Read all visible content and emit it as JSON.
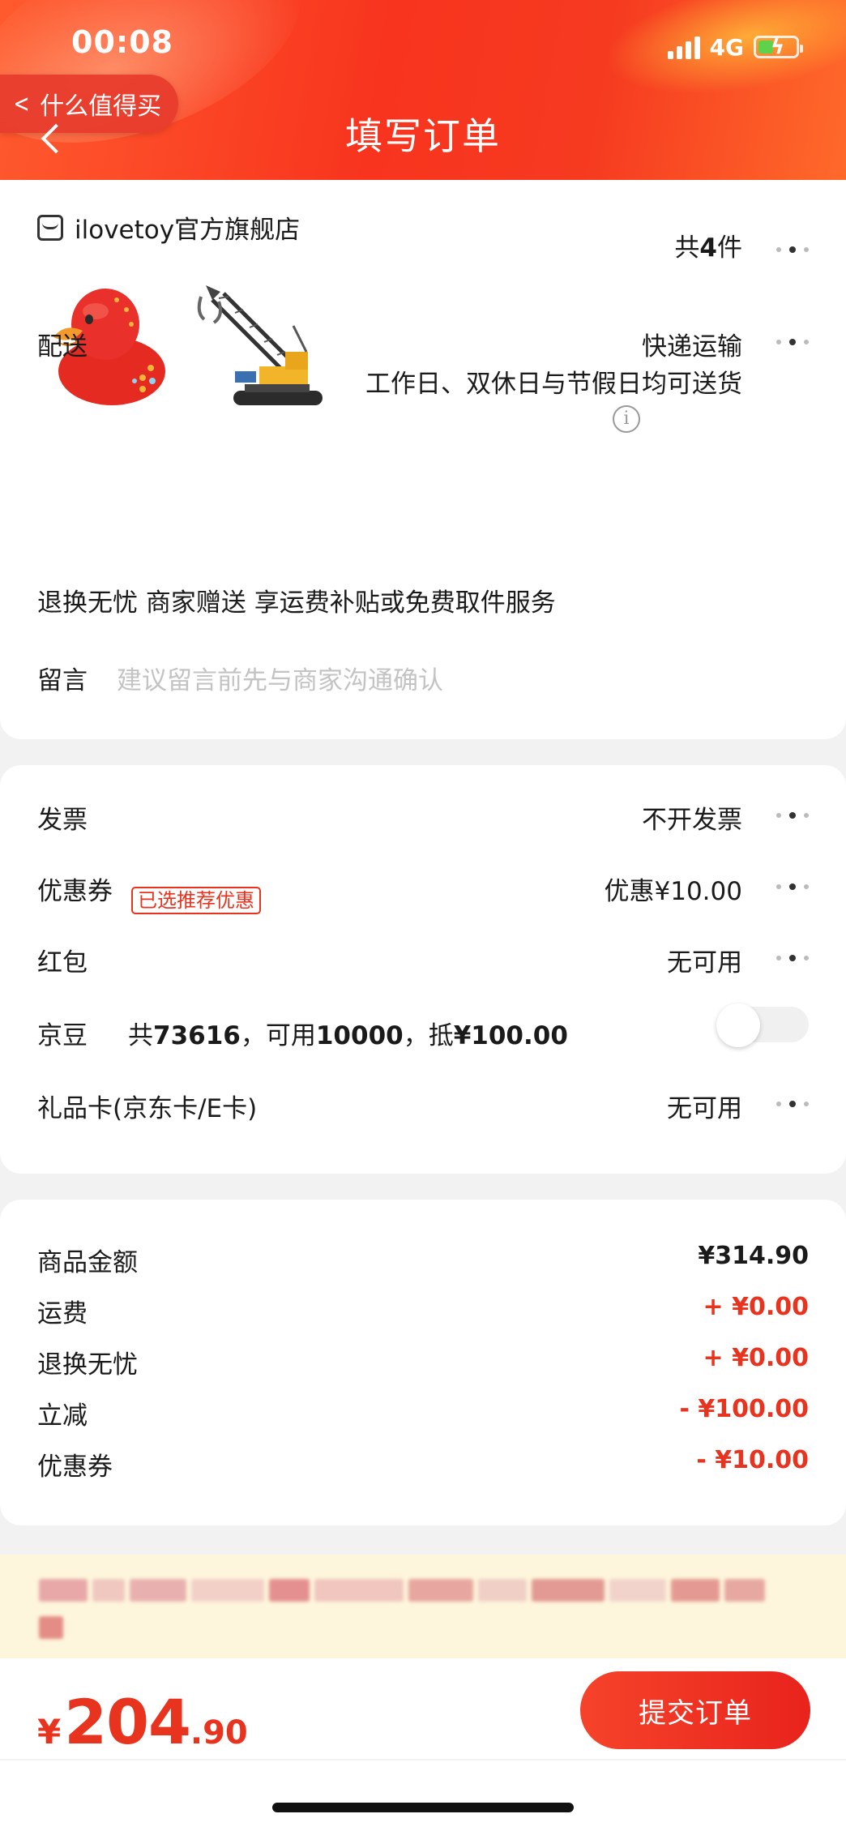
{
  "status_bar": {
    "time": "00:08",
    "network": "4G"
  },
  "nav": {
    "back_app_label": "什么值得买",
    "title": "填写订单"
  },
  "store": {
    "name": "ilovetoy官方旗舰店"
  },
  "products": {
    "count_prefix": "共",
    "count": "4",
    "count_suffix": "件"
  },
  "delivery": {
    "label": "配送",
    "method": "快递运输",
    "schedule": "工作日、双休日与节假日均可送货"
  },
  "return_service": {
    "text": "退换无忧 商家赠送 享运费补贴或免费取件服务"
  },
  "message": {
    "label": "留言",
    "placeholder": "建议留言前先与商家沟通确认"
  },
  "invoice": {
    "label": "发票",
    "value": "不开发票"
  },
  "coupon": {
    "label": "优惠券",
    "tag": "已选推荐优惠",
    "value": "优惠¥10.00"
  },
  "red_packet": {
    "label": "红包",
    "value": "无可用"
  },
  "jingdou": {
    "label": "京豆",
    "total_prefix": "共",
    "total": "73616",
    "usable_prefix": "，可用",
    "usable": "10000",
    "deduct_prefix": "，抵",
    "deduct": "¥100.00",
    "toggle_on": false
  },
  "gift_card": {
    "label": "礼品卡(京东卡/E卡)",
    "value": "无可用"
  },
  "amounts": [
    {
      "label": "商品金额",
      "value": "¥314.90",
      "color": "#1a1a1a"
    },
    {
      "label": "运费",
      "value": "+ ¥0.00",
      "color": "#e8331f"
    },
    {
      "label": "退换无忧",
      "value": "+ ¥0.00",
      "color": "#e8331f"
    },
    {
      "label": "立减",
      "value": "- ¥100.00",
      "color": "#e8331f"
    },
    {
      "label": "优惠券",
      "value": "- ¥10.00",
      "color": "#e8331f"
    }
  ],
  "total": {
    "currency": "¥",
    "integer": "204",
    "decimal": ".90"
  },
  "submit": {
    "label": "提交订单"
  },
  "colors": {
    "brand_red": "#e8331f",
    "notice_bg": "#fdf6dc"
  }
}
